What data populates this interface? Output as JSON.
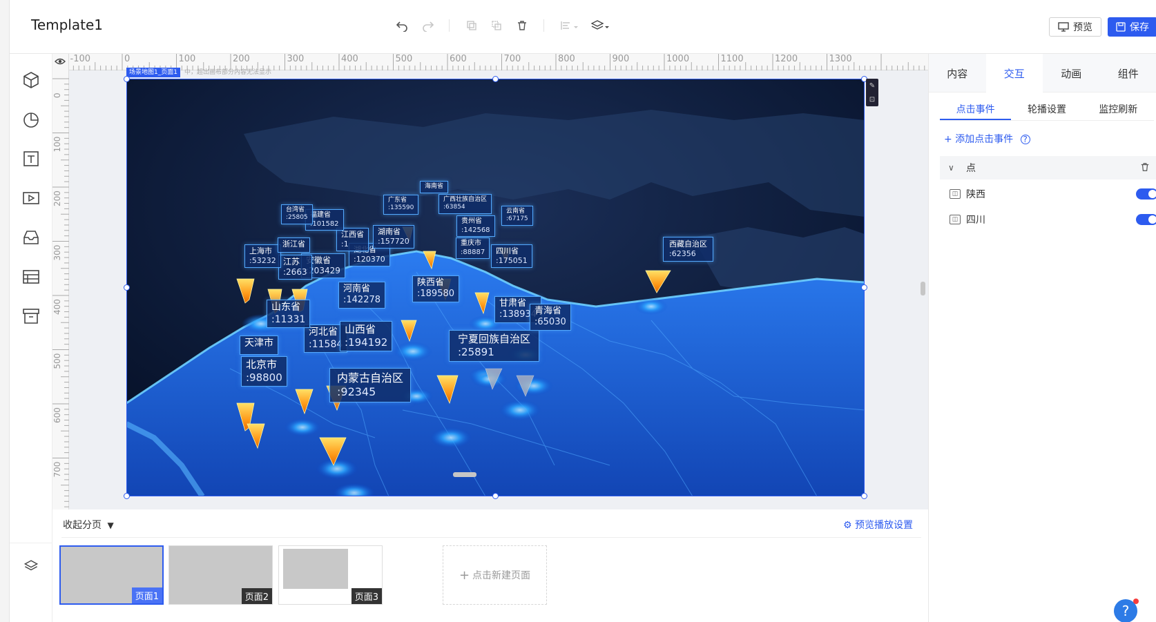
{
  "app": {
    "title": "Template1"
  },
  "toolbar": {
    "undo_icon": "undo-icon",
    "redo_icon": "redo-icon",
    "copy_icon": "copy-icon",
    "duplicate_icon": "duplicate-icon",
    "delete_icon": "trash-icon",
    "align_icon": "align-icon",
    "layer_icon": "layers-icon",
    "preview_label": "预览",
    "save_label": "保存"
  },
  "sidebar": {
    "items": [
      "3d-box-icon",
      "pie-chart-icon",
      "text-icon",
      "video-icon",
      "inbox-icon",
      "table-icon",
      "archive-icon",
      "layers-icon"
    ]
  },
  "rulers": {
    "top": [
      "-100",
      "0",
      "100",
      "200",
      "300",
      "400",
      "500",
      "600",
      "700",
      "800",
      "900",
      "1000",
      "1100",
      "1200",
      "1300"
    ],
    "left": [
      "0",
      "100",
      "200",
      "300",
      "400",
      "500",
      "600",
      "700"
    ]
  },
  "stage": {
    "tag": "场景地图1_页面1",
    "note": "中，超出画布部分内容无法显示"
  },
  "map_labels": [
    {
      "name": "北京市",
      "value": ":98800"
    },
    {
      "name": "天津市",
      "value": ""
    },
    {
      "name": "河北省",
      "value": ":11584"
    },
    {
      "name": "山西省",
      "value": ":194192"
    },
    {
      "name": "内蒙古自治区",
      "value": ":92345"
    },
    {
      "name": "山东省",
      "value": ":11331"
    },
    {
      "name": "河南省",
      "value": ":142278"
    },
    {
      "name": "陕西省",
      "value": ":189580"
    },
    {
      "name": "宁夏回族自治区",
      "value": ":25891"
    },
    {
      "name": "甘肃省",
      "value": ":138934"
    },
    {
      "name": "青海省",
      "value": ":65030"
    },
    {
      "name": "西藏自治区",
      "value": ":62356"
    },
    {
      "name": "四川省",
      "value": ":175051"
    },
    {
      "name": "重庆市",
      "value": ":88887"
    },
    {
      "name": "贵州省",
      "value": ":142568"
    },
    {
      "name": "云南省",
      "value": ":67175"
    },
    {
      "name": "广西壮族自治区",
      "value": ":63854"
    },
    {
      "name": "湖北省",
      "value": ":120370"
    },
    {
      "name": "湖南省",
      "value": ":157720"
    },
    {
      "name": "江西省",
      "value": ":1"
    },
    {
      "name": "安徽省",
      "value": ":203429"
    },
    {
      "name": "江苏",
      "value": ":2663"
    },
    {
      "name": "上海市",
      "value": ":53232"
    },
    {
      "name": "浙江省",
      "value": ""
    },
    {
      "name": "福建省",
      "value": ":101582"
    },
    {
      "name": "台湾省",
      "value": ":25805"
    },
    {
      "name": "广东省",
      "value": ":135590"
    },
    {
      "name": "海南省",
      "value": ""
    }
  ],
  "pages_panel": {
    "collapse_label": "收起分页",
    "preview_setting_label": "预览播放设置",
    "pages": [
      "页面1",
      "页面2",
      "页面3"
    ],
    "new_page_label": "点击新建页面"
  },
  "right_panel": {
    "tabs": [
      "内容",
      "交互",
      "动画",
      "组件"
    ],
    "active_tab": "交互",
    "subtabs": [
      "点击事件",
      "轮播设置",
      "监控刷新"
    ],
    "add_event_label": "添加点击事件",
    "group_name": "点",
    "items": [
      {
        "label": "陕西",
        "enabled": true
      },
      {
        "label": "四川",
        "enabled": true
      }
    ]
  },
  "colors": {
    "accent": "#2d5bef",
    "map_bg": "#0b1c3f",
    "map_land": "#1a5fd4"
  }
}
